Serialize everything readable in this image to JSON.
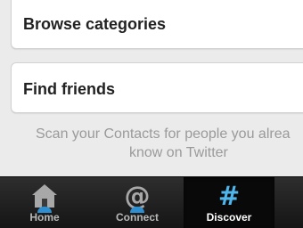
{
  "cards": {
    "browse": {
      "label": "Browse categories"
    },
    "find": {
      "label": "Find friends"
    }
  },
  "find_description": {
    "line1": "Scan your Contacts for people you alrea",
    "line2": "know on Twitter"
  },
  "tabbar": {
    "tabs": [
      {
        "label": "Home",
        "icon": "house-icon",
        "active": false
      },
      {
        "label": "Connect",
        "icon": "at-icon",
        "glyph": "@",
        "active": false
      },
      {
        "label": "Discover",
        "icon": "hashtag-icon",
        "glyph": "#",
        "active": true
      }
    ]
  },
  "colors": {
    "background": "#ebebeb",
    "card": "#ffffff",
    "tabbar": "#1f1f1f",
    "active_icon": "#4fb6ec",
    "inactive_icon": "#a8a8a8"
  }
}
